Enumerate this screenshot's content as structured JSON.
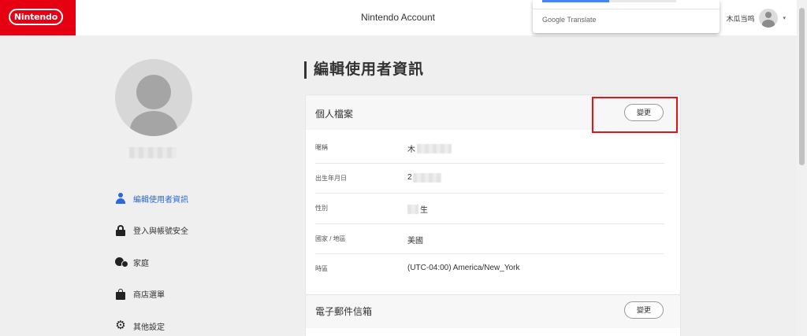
{
  "header": {
    "logo": "Nintendo",
    "title": "Nintendo Account",
    "user_name": "木瓜当呜",
    "caret": "▾"
  },
  "translate_popup": {
    "label_google": "Google",
    "label_translate": "Translate"
  },
  "profile": {
    "name_blurred": ""
  },
  "sidebar": {
    "items": [
      {
        "label": "編輯使用者資訊",
        "icon": "person-icon",
        "active": true
      },
      {
        "label": "登入與帳號安全",
        "icon": "lock-icon",
        "active": false
      },
      {
        "label": "家庭",
        "icon": "family-icon",
        "active": false
      },
      {
        "label": "商店選單",
        "icon": "shopping-bag-icon",
        "active": false
      },
      {
        "label": "其他設定",
        "icon": "gear-icon",
        "active": false
      }
    ]
  },
  "main": {
    "page_title": "編輯使用者資訊",
    "profile_card": {
      "title": "個人檔案",
      "change_label": "變更",
      "rows": [
        {
          "label": "暱稱",
          "value": "木"
        },
        {
          "label": "出生年月日",
          "value": "2"
        },
        {
          "label": "性別",
          "value": "生"
        },
        {
          "label": "國家 / 地區",
          "value": "美國"
        },
        {
          "label": "時區",
          "value": "(UTC-04:00) America/New_York"
        }
      ]
    },
    "email_card": {
      "title": "電子郵件信箱",
      "change_label": "變更"
    }
  },
  "colors": {
    "brand_red": "#e60012",
    "highlight_red": "#e8111a",
    "active_blue": "#2b67d8"
  }
}
